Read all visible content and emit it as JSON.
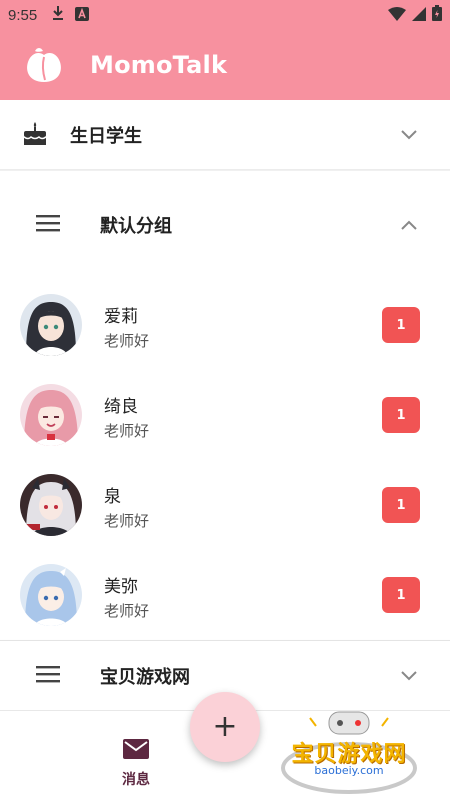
{
  "status_bar": {
    "time": "9:55",
    "left_icons": [
      "download-icon",
      "a-letter-icon"
    ],
    "right_icons": [
      "wifi-icon",
      "signal-icon",
      "battery-icon"
    ]
  },
  "header": {
    "logo_icon": "peach-icon",
    "title": "MomoTalk",
    "bg_color": "#f7919f"
  },
  "sections": {
    "birthday": {
      "icon": "cake-icon",
      "label": "生日学生",
      "state": "collapsed"
    },
    "default_group": {
      "icon": "menu-icon",
      "label": "默认分组",
      "state": "expanded"
    },
    "baobei_group": {
      "icon": "menu-icon",
      "label": "宝贝游戏网",
      "state": "collapsed"
    }
  },
  "contacts": [
    {
      "name": "爱莉",
      "message": "老师好",
      "unread": "1"
    },
    {
      "name": "绮良",
      "message": "老师好",
      "unread": "1"
    },
    {
      "name": "泉",
      "message": "老师好",
      "unread": "1"
    },
    {
      "name": "美弥",
      "message": "老师好",
      "unread": "1"
    }
  ],
  "bottom_nav": {
    "messages": {
      "icon": "mail-icon",
      "label": "消息",
      "color": "#5d2841"
    }
  },
  "fab": {
    "icon": "plus-icon",
    "label": "+"
  },
  "watermark": {
    "text": "宝贝游戏网",
    "url": "baobeiy.com"
  },
  "colors": {
    "badge": "#f15454",
    "accent": "#f7919f",
    "fab": "#fbd1d7"
  }
}
